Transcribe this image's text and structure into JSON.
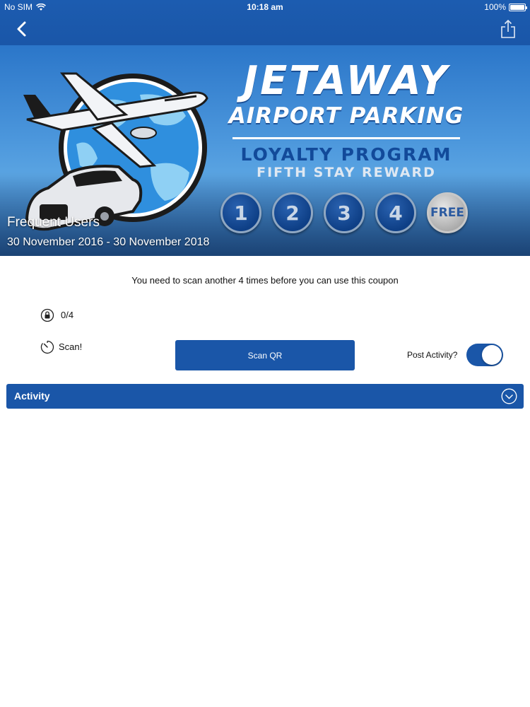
{
  "status_bar": {
    "carrier": "No SIM",
    "time": "10:18 am",
    "battery": "100%",
    "battery_level": 1.0
  },
  "nav": {
    "back_icon": "chevron-left-icon",
    "share_icon": "share-icon"
  },
  "banner": {
    "brand_line1": "JETAWAY",
    "brand_line2": "AIRPORT PARKING",
    "program": "LOYALTY PROGRAM",
    "reward": "FIFTH STAY REWARD",
    "stamps": [
      "1",
      "2",
      "3",
      "4",
      "FREE"
    ],
    "title": "Frequent Users",
    "dates": "30 November 2016 - 30 November 2018"
  },
  "coupon": {
    "notice": "You need to scan another 4 times before you can use this coupon",
    "progress": "0/4",
    "progress_icon": "lock-icon",
    "scan_label": "Scan!",
    "scan_icon": "timer-icon",
    "scan_button": "Scan QR",
    "post_activity_label": "Post Activity?",
    "post_activity_on": true
  },
  "activity": {
    "label": "Activity",
    "icon": "chevron-down-circle-icon"
  },
  "colors": {
    "primary": "#1a56a8",
    "background": "#ffffff"
  }
}
